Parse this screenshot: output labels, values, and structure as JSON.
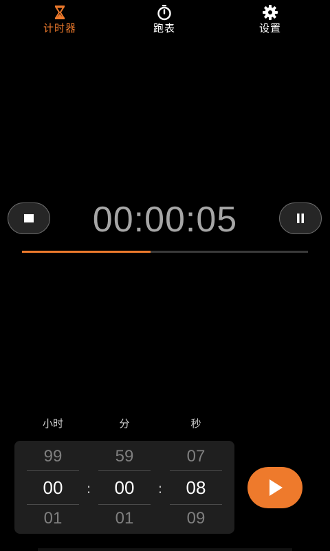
{
  "tabs": [
    {
      "id": "timer",
      "label": "计时器",
      "icon": "hourglass-icon",
      "active": true
    },
    {
      "id": "stopwatch",
      "label": "跑表",
      "icon": "stopwatch-icon",
      "active": false
    },
    {
      "id": "settings",
      "label": "设置",
      "icon": "gear-icon",
      "active": false
    }
  ],
  "timer": {
    "display": "00:00:05",
    "progress": 0.45,
    "stop_icon": "stop-icon",
    "pause_icon": "pause-icon"
  },
  "picker": {
    "labels": {
      "hours": "小时",
      "minutes": "分",
      "seconds": "秒"
    },
    "separator": ":",
    "hours": {
      "prev": "99",
      "current": "00",
      "next": "01"
    },
    "minutes": {
      "prev": "59",
      "current": "00",
      "next": "01"
    },
    "seconds": {
      "prev": "07",
      "current": "08",
      "next": "09"
    },
    "play_icon": "play-icon"
  },
  "colors": {
    "accent": "#ee7a2c",
    "background": "#000000",
    "panel": "#1f1f1f",
    "time_text": "#a6a6a6"
  }
}
